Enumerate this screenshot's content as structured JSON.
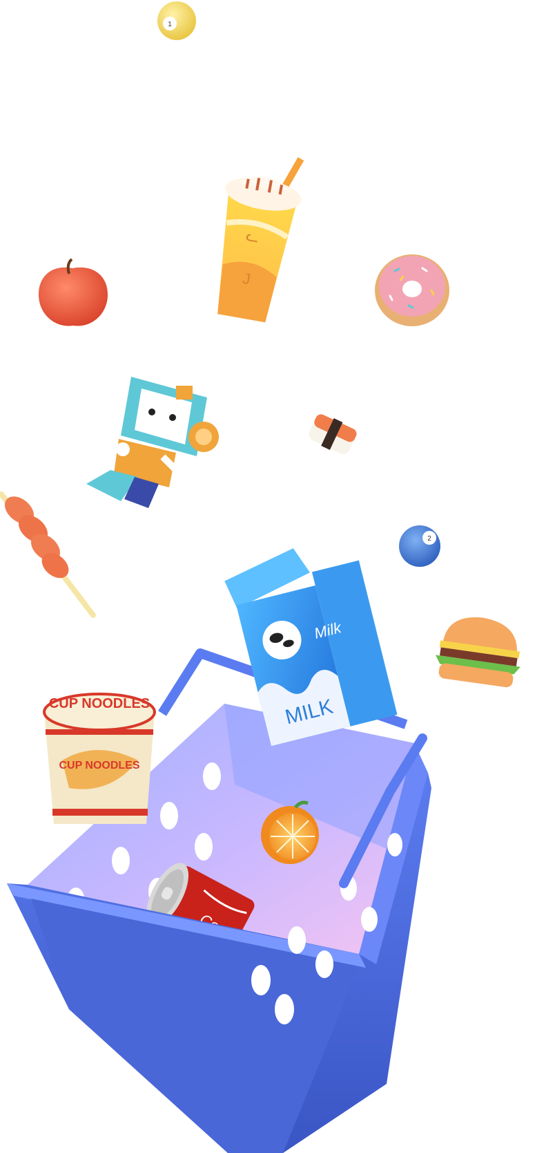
{
  "scene": {
    "colors": {
      "background": "#ffffff",
      "basket": "#4f6fe0",
      "basket_dark": "#3b56c2",
      "basket_inner": "#b9a4f0",
      "milk_blue": "#2f8fe8",
      "robot_teal": "#5fc8d6",
      "robot_orange": "#f0a43a",
      "soda_red": "#c8221b",
      "noodle_red": "#d8382a",
      "noodle_cream": "#f4e8c8"
    },
    "items": [
      {
        "name": "billiard-ball-1",
        "number": "1"
      },
      {
        "name": "milkshake-cup"
      },
      {
        "name": "apple"
      },
      {
        "name": "donut"
      },
      {
        "name": "robot-toy"
      },
      {
        "name": "sushi"
      },
      {
        "name": "shrimp-skewer"
      },
      {
        "name": "billiard-ball-2",
        "number": "2"
      },
      {
        "name": "milk-carton",
        "brand": "Milk",
        "label": "MILK"
      },
      {
        "name": "burger"
      },
      {
        "name": "cup-noodles",
        "label_top": "CUP NOODLES",
        "label_side": "CUP NOODLES"
      },
      {
        "name": "orange-half"
      },
      {
        "name": "soda-can",
        "brand": "Coca-Cola"
      },
      {
        "name": "shopping-basket"
      }
    ]
  }
}
